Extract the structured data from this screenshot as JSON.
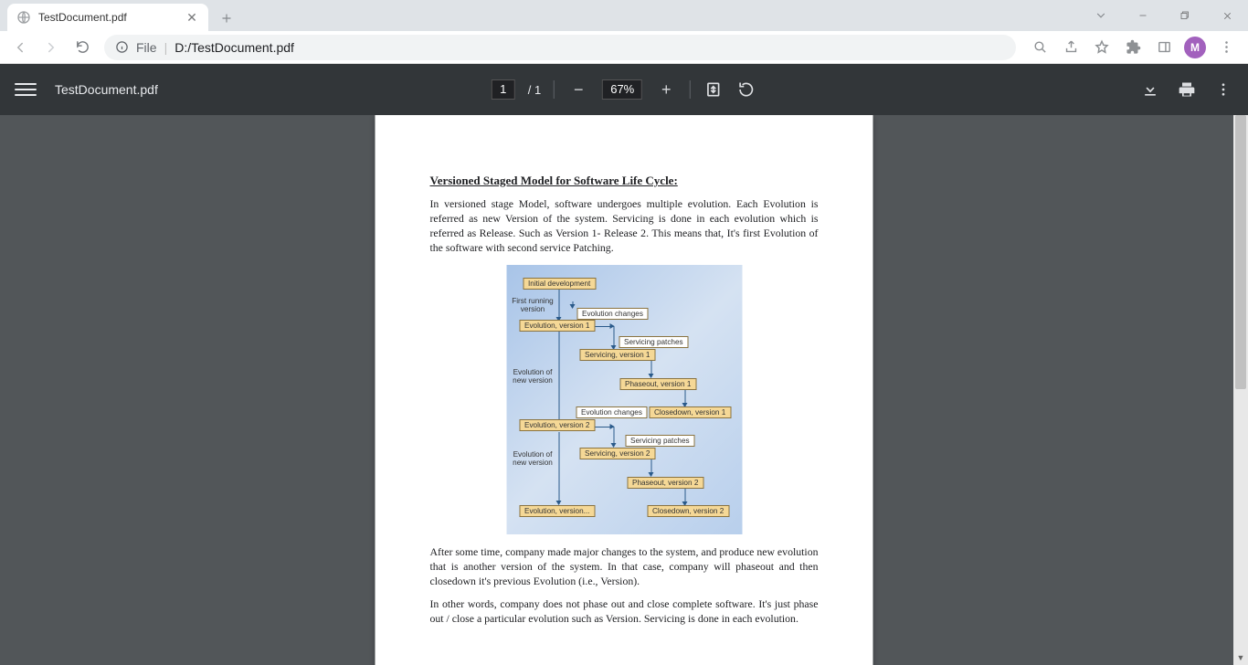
{
  "browser": {
    "tab_title": "TestDocument.pdf",
    "omnibox_prefix": "File",
    "omnibox_path": "D:/TestDocument.pdf",
    "avatar_letter": "M"
  },
  "pdf_toolbar": {
    "filename": "TestDocument.pdf",
    "page_current": "1",
    "page_total": "/  1",
    "zoom": "67%"
  },
  "document": {
    "title": "Versioned Staged Model for Software Life Cycle:",
    "para1": "In versioned stage Model, software undergoes multiple evolution. Each Evolution is referred as new Version of the system. Servicing is done in each evolution which is referred as Release. Such as Version 1- Release 2. This means that, It's first Evolution of the software with second service Patching.",
    "para2": "After some time, company made major changes to the system, and produce new evolution that is another version of the system. In that case, company will phaseout and then closedown  it's previous Evolution (i.e., Version).",
    "para3": "In other words, company does not phase out and close complete software. It's just phase out / close a particular evolution such as Version. Servicing is done in each evolution."
  },
  "diagram": {
    "initial_dev": "Initial development",
    "first_running": "First running\nversion",
    "evo_changes1": "Evolution changes",
    "evo_v1": "Evolution, version 1",
    "serv_patches1": "Servicing patches",
    "serv_v1": "Servicing, version 1",
    "evo_new1": "Evolution of\nnew version",
    "phaseout_v1": "Phaseout, version 1",
    "evo_changes2": "Evolution changes",
    "closedown_v1": "Closedown, version 1",
    "evo_v2": "Evolution, version 2",
    "serv_patches2": "Servicing patches",
    "serv_v2": "Servicing, version 2",
    "evo_new2": "Evolution of\nnew version",
    "phaseout_v2": "Phaseout, version 2",
    "evo_v3": "Evolution, version...",
    "closedown_v2": "Closedown, version 2"
  }
}
